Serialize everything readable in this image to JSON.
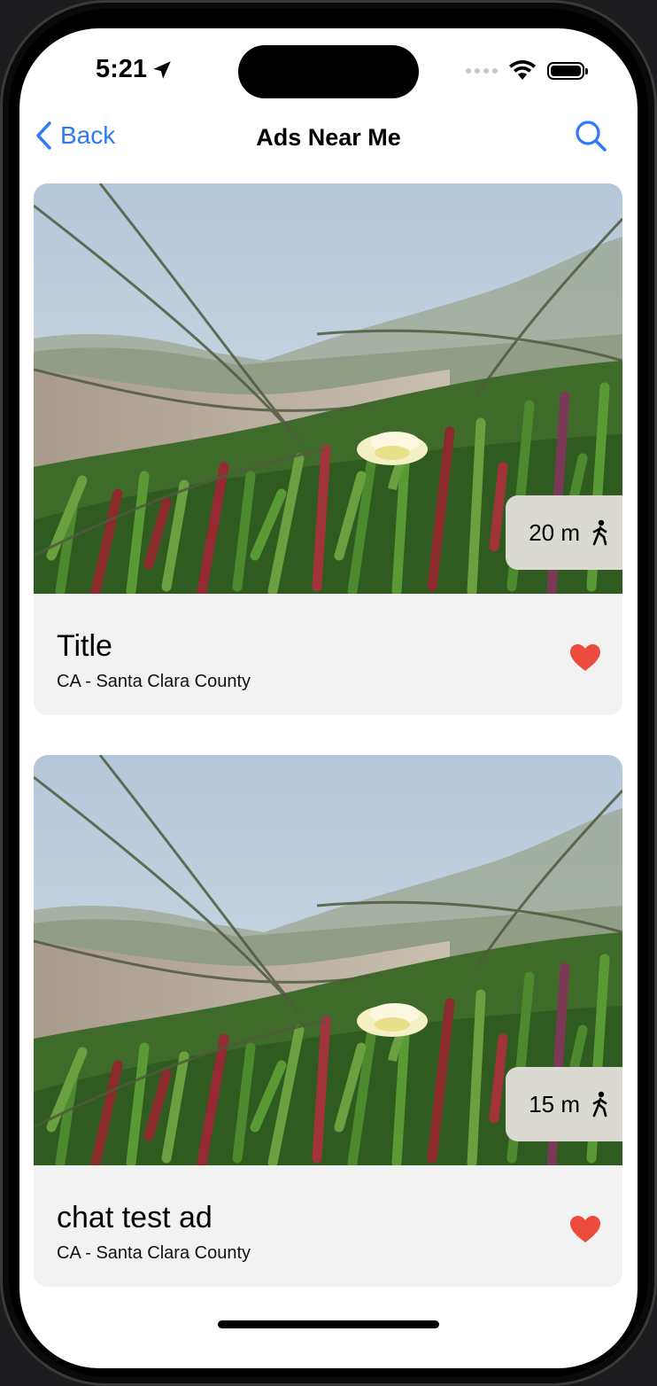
{
  "status": {
    "time": "5:21"
  },
  "nav": {
    "back_label": "Back",
    "title": "Ads Near Me"
  },
  "colors": {
    "accent": "#2f7bf6",
    "heart": "#ec4b3e",
    "badge": "#dad9d2"
  },
  "icons": {
    "location": "location-arrow-icon",
    "wifi": "wifi-icon",
    "battery": "battery-icon",
    "back": "chevron-left-icon",
    "search": "magnifying-glass-icon",
    "walk": "walking-person-icon",
    "favorite": "heart-icon"
  },
  "ads": [
    {
      "title": "Title",
      "location": "CA - Santa Clara County",
      "distance": "20 m"
    },
    {
      "title": "chat test ad",
      "location": "CA - Santa Clara County",
      "distance": "15 m"
    }
  ]
}
